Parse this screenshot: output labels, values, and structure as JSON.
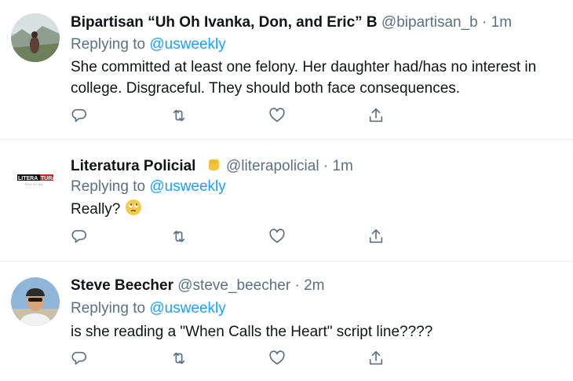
{
  "tweets": [
    {
      "name": "Bipartisan “Uh Oh Ivanka, Don, and Eric” B",
      "handle": "@bipartisan_b",
      "dot": "·",
      "time": "1m",
      "replying_prefix": "Replying to",
      "replying_to": "@usweekly",
      "text": "She committed at least one felony. Her daughter had/has no interest in college. Disgraceful. They should both face consequences."
    },
    {
      "name": "Literatura Policial",
      "name_emoji": "raised-fist-emoji",
      "handle": "@literapolicial",
      "dot": "·",
      "time": "1m",
      "replying_prefix": "Replying to",
      "replying_to": "@usweekly",
      "text": "Really?",
      "text_emoji": "eye-roll-emoji",
      "avatar_logo_text": "LITERATURA",
      "avatar_logo_sub": "POLICIAL"
    },
    {
      "name": "Steve Beecher",
      "handle": "@steve_beecher",
      "dot": "·",
      "time": "2m",
      "replying_prefix": "Replying to",
      "replying_to": "@usweekly",
      "text": "is she reading a \"When Calls the Heart\" script line????"
    }
  ],
  "icons": {
    "reply": "reply-icon",
    "retweet": "retweet-icon",
    "like": "heart-icon",
    "share": "share-icon"
  },
  "colors": {
    "link": "#1da1f2",
    "secondary": "#5b7083",
    "divider": "#e6ecf0"
  }
}
